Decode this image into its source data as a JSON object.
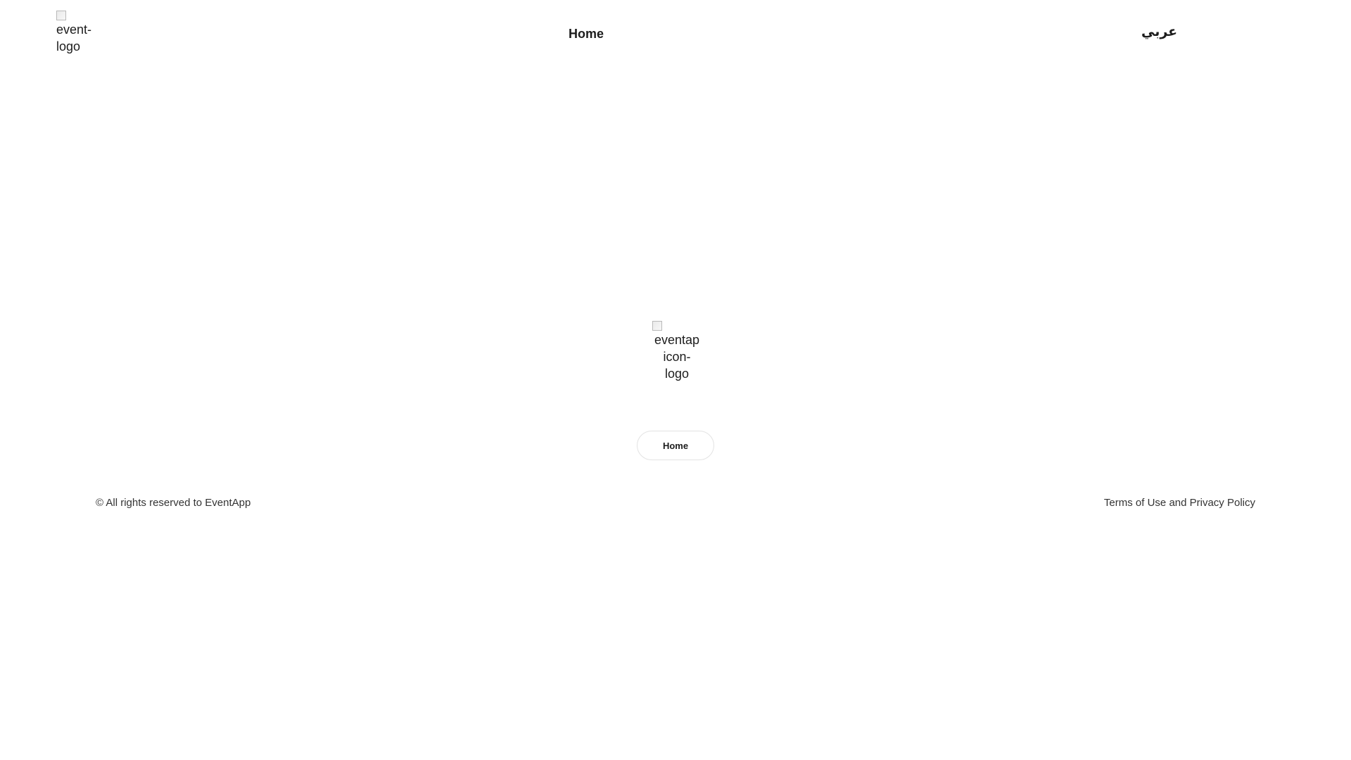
{
  "header": {
    "logo_alt": "event-logo",
    "nav": {
      "home_label": "Home"
    },
    "language_toggle": "عربي"
  },
  "footer": {
    "logo_alt": "eventap icon-logo",
    "home_button": "Home",
    "copyright": "© All rights reserved to EventApp",
    "terms_link": "Terms of Use and Privacy Policy"
  },
  "colors": {
    "background": "#ffffff",
    "text": "#1c1c1c",
    "button_border": "#e3e3e3"
  }
}
